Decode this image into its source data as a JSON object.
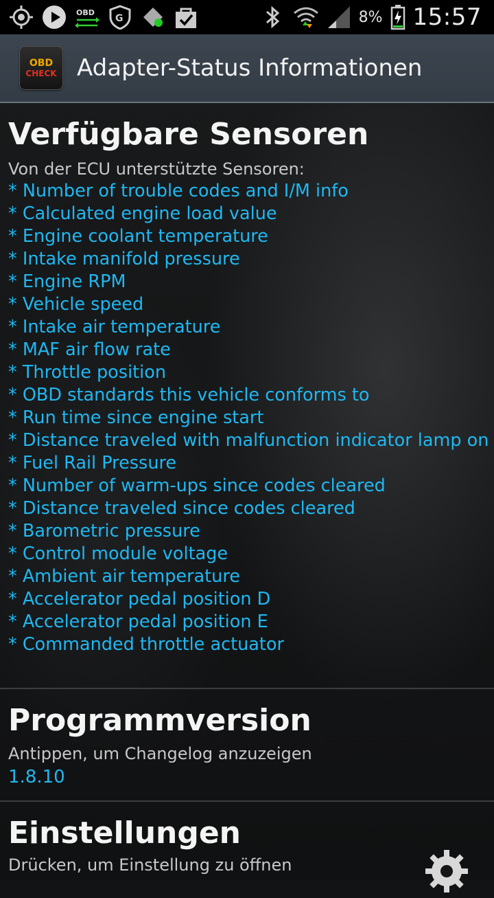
{
  "status_bar": {
    "obd_label": "OBD",
    "battery": "8%",
    "time": "15:57",
    "icons": [
      "gps-icon",
      "play-icon",
      "obd-icon",
      "shield-icon",
      "location-icon",
      "bag-icon",
      "bluetooth-icon",
      "wifi-icon",
      "signal-icon",
      "battery-icon"
    ]
  },
  "app_bar": {
    "icon_text_top": "OBD",
    "icon_text_bottom": "CHECK",
    "title": "Adapter-Status Informationen"
  },
  "sensors": {
    "title": "Verfügbare Sensoren",
    "subtitle": "Von der ECU unterstützte Sensoren:",
    "items": [
      "* Number of trouble codes and I/M info",
      "* Calculated engine load value",
      "* Engine coolant temperature",
      "* Intake manifold pressure",
      "* Engine RPM",
      "* Vehicle speed",
      "* Intake air temperature",
      "* MAF air flow rate",
      "* Throttle position",
      "* OBD standards this vehicle conforms to",
      "* Run time since engine start",
      "* Distance traveled with malfunction indicator lamp on",
      "* Fuel Rail Pressure",
      "* Number of warm-ups since codes cleared",
      "* Distance traveled since codes cleared",
      "* Barometric pressure",
      "* Control module voltage",
      "* Ambient air temperature",
      "* Accelerator pedal position D",
      "* Accelerator pedal position E",
      "* Commanded throttle actuator"
    ]
  },
  "program": {
    "title": "Programmversion",
    "subtitle": "Antippen, um Changelog anzuzeigen",
    "version": "1.8.10"
  },
  "settings": {
    "title": "Einstellungen",
    "subtitle": "Drücken, um Einstellung zu öffnen"
  },
  "colors": {
    "accent": "#1fb8f2",
    "action_bar": "#3a434c",
    "background": "#141516"
  }
}
